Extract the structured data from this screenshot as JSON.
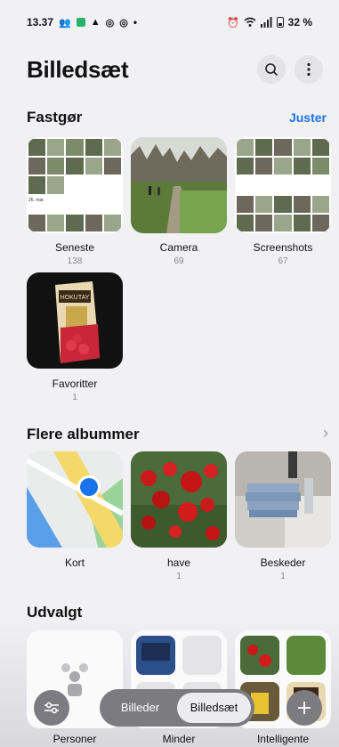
{
  "status": {
    "time": "13.37",
    "battery": "32 %",
    "dot": "•"
  },
  "header": {
    "title": "Billedsæt"
  },
  "pinned": {
    "title": "Fastgør",
    "action": "Juster",
    "albums": [
      {
        "name": "Seneste",
        "count": "138"
      },
      {
        "name": "Camera",
        "count": "69"
      },
      {
        "name": "Screenshots",
        "count": "67"
      },
      {
        "name": "Favoritter",
        "count": "1"
      }
    ]
  },
  "more": {
    "title": "Flere albummer",
    "albums": [
      {
        "name": "Kort",
        "count": ""
      },
      {
        "name": "have",
        "count": "1"
      },
      {
        "name": "Beskeder",
        "count": "1"
      }
    ]
  },
  "featured": {
    "title": "Udvalgt",
    "cards": [
      {
        "name": "Personer"
      },
      {
        "name": "Minder"
      },
      {
        "name": "Intelligente"
      }
    ]
  },
  "thumb_text": {
    "date_label": "26. mar.",
    "snack_brand": "HOKUTAY"
  },
  "bottom_nav": {
    "tabs": [
      "Billeder",
      "Billedsæt"
    ],
    "active": "Billedsæt"
  },
  "colors": {
    "accent": "#1a73e8",
    "background": "#f1f1f4"
  }
}
